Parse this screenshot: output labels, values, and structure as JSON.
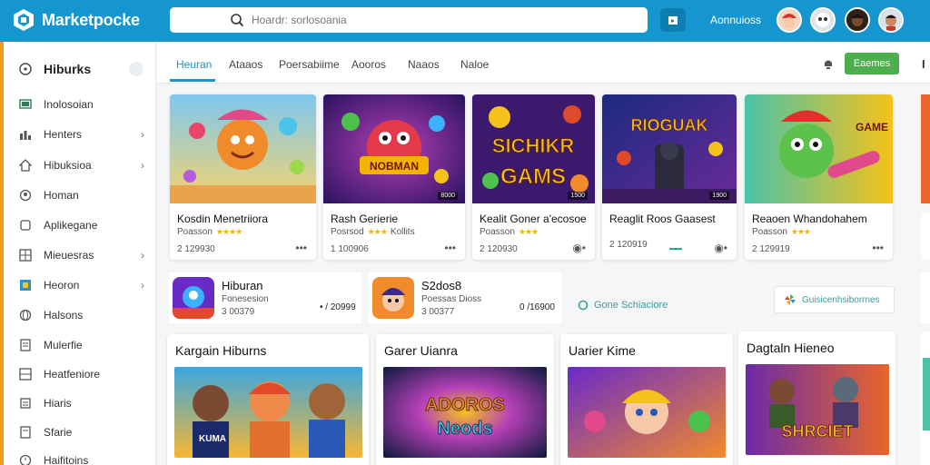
{
  "header": {
    "app_name": "Marketpocke",
    "search_placeholder": "Hoardr: sorlosoania",
    "link_label": "Aonnuioss",
    "avatars": [
      "avatar-red-hat",
      "avatar-ghost",
      "avatar-dark",
      "avatar-boy"
    ]
  },
  "sidebar": {
    "heading": "Hiburks",
    "items": [
      {
        "label": "Inolosoian",
        "icon": "monitor-icon",
        "chevron": false
      },
      {
        "label": "Henters",
        "icon": "chart-icon",
        "chevron": true
      },
      {
        "label": "Hibuksioa",
        "icon": "home-icon",
        "chevron": true
      },
      {
        "label": "Homan",
        "icon": "person-icon",
        "chevron": false
      },
      {
        "label": "Aplikegane",
        "icon": "app-icon",
        "chevron": false
      },
      {
        "label": "Mieuesras",
        "icon": "grid-icon",
        "chevron": true
      },
      {
        "label": "Heoron",
        "icon": "square-icon",
        "chevron": true
      },
      {
        "label": "Halsons",
        "icon": "globe-icon",
        "chevron": false
      },
      {
        "label": "Mulerfie",
        "icon": "doc-icon",
        "chevron": false
      },
      {
        "label": "Heatfeniore",
        "icon": "grid-icon",
        "chevron": false
      },
      {
        "label": "Hiaris",
        "icon": "list-icon",
        "chevron": false
      },
      {
        "label": "Sfarie",
        "icon": "doc-icon",
        "chevron": false
      },
      {
        "label": "Haifitoins",
        "icon": "clock-icon",
        "chevron": false
      }
    ]
  },
  "tabs": {
    "items": [
      "Heuran",
      "Ataaos",
      "Poersabiime",
      "Aooros",
      "Naaos",
      "Naloe"
    ],
    "active": 0,
    "cta_label": "Eaemes",
    "edge_label": "I"
  },
  "cards": [
    {
      "title": "Kosdin Menetriiora",
      "sub": "Poasson",
      "stars": "★★★★",
      "price": "2 129930",
      "menu": "•••",
      "badge": ""
    },
    {
      "title": "Rash Gerierie",
      "sub": "Posrsod",
      "stars": "★★★",
      "extra": "Kollits",
      "price": "1 100906",
      "menu": "•••",
      "badge": "8000"
    },
    {
      "title": "Kealit Goner a'ecosoe",
      "sub": "Poasson",
      "stars": "★★★",
      "price": "2 120930",
      "menu": "◉•",
      "badge": "1500"
    },
    {
      "title": "Reaglit Roos Gaasest",
      "sub": "",
      "stars": "",
      "price": "2 120919",
      "menu": "◉•",
      "badge": "1900"
    },
    {
      "title": "Reaoen Whandohahem",
      "sub": "Poasson",
      "stars": "★★★",
      "price": "2 129919",
      "menu": "•••",
      "badge": ""
    }
  ],
  "card_art": [
    {
      "text": "",
      "bg1": "#f6d36b",
      "bg2": "#7ec8f0"
    },
    {
      "text": "NOBMAN",
      "bg1": "#2a1360",
      "bg2": "#8b2fa8"
    },
    {
      "text": "SICHIKR GAMS",
      "bg1": "#3b1a6e",
      "bg2": "#1f0f40"
    },
    {
      "text": "RIOGUAK",
      "bg1": "#1c2a80",
      "bg2": "#5a2a8a"
    },
    {
      "text": "GAME",
      "bg1": "#f5c21b",
      "bg2": "#e8482b"
    }
  ],
  "mini": [
    {
      "title": "Hiburan",
      "sub": "Fonesesion ",
      "val": "3 00379",
      "price": "• / 20999"
    },
    {
      "title": "S2dos8",
      "sub": "Poessas Dioss",
      "val": "3 00377",
      "price": "0 /16900"
    }
  ],
  "mini_link": "Gone Schiaciore",
  "mini_pill": "Guisicenhsiborrnes",
  "panels": [
    {
      "title": "Kargain Hiburns",
      "art": "KUMA",
      "bg1": "#f7b733",
      "bg2": "#3aa7e0"
    },
    {
      "title": "Garer Uianra",
      "art": "ADOROS Neods",
      "bg1": "#5b1c8a",
      "bg2": "#0f3a6e"
    },
    {
      "title": "Uarier Kime",
      "art": "",
      "bg1": "#d43a9c",
      "bg2": "#f28a2b"
    },
    {
      "title": "Dagtaln Hieneo",
      "art": "SHRCIET",
      "bg1": "#6b2aa8",
      "bg2": "#e8662c"
    }
  ],
  "colors": {
    "topbar": "#1596cf",
    "accent_orange": "#f39b1f",
    "cta_green": "#4cae4c"
  }
}
